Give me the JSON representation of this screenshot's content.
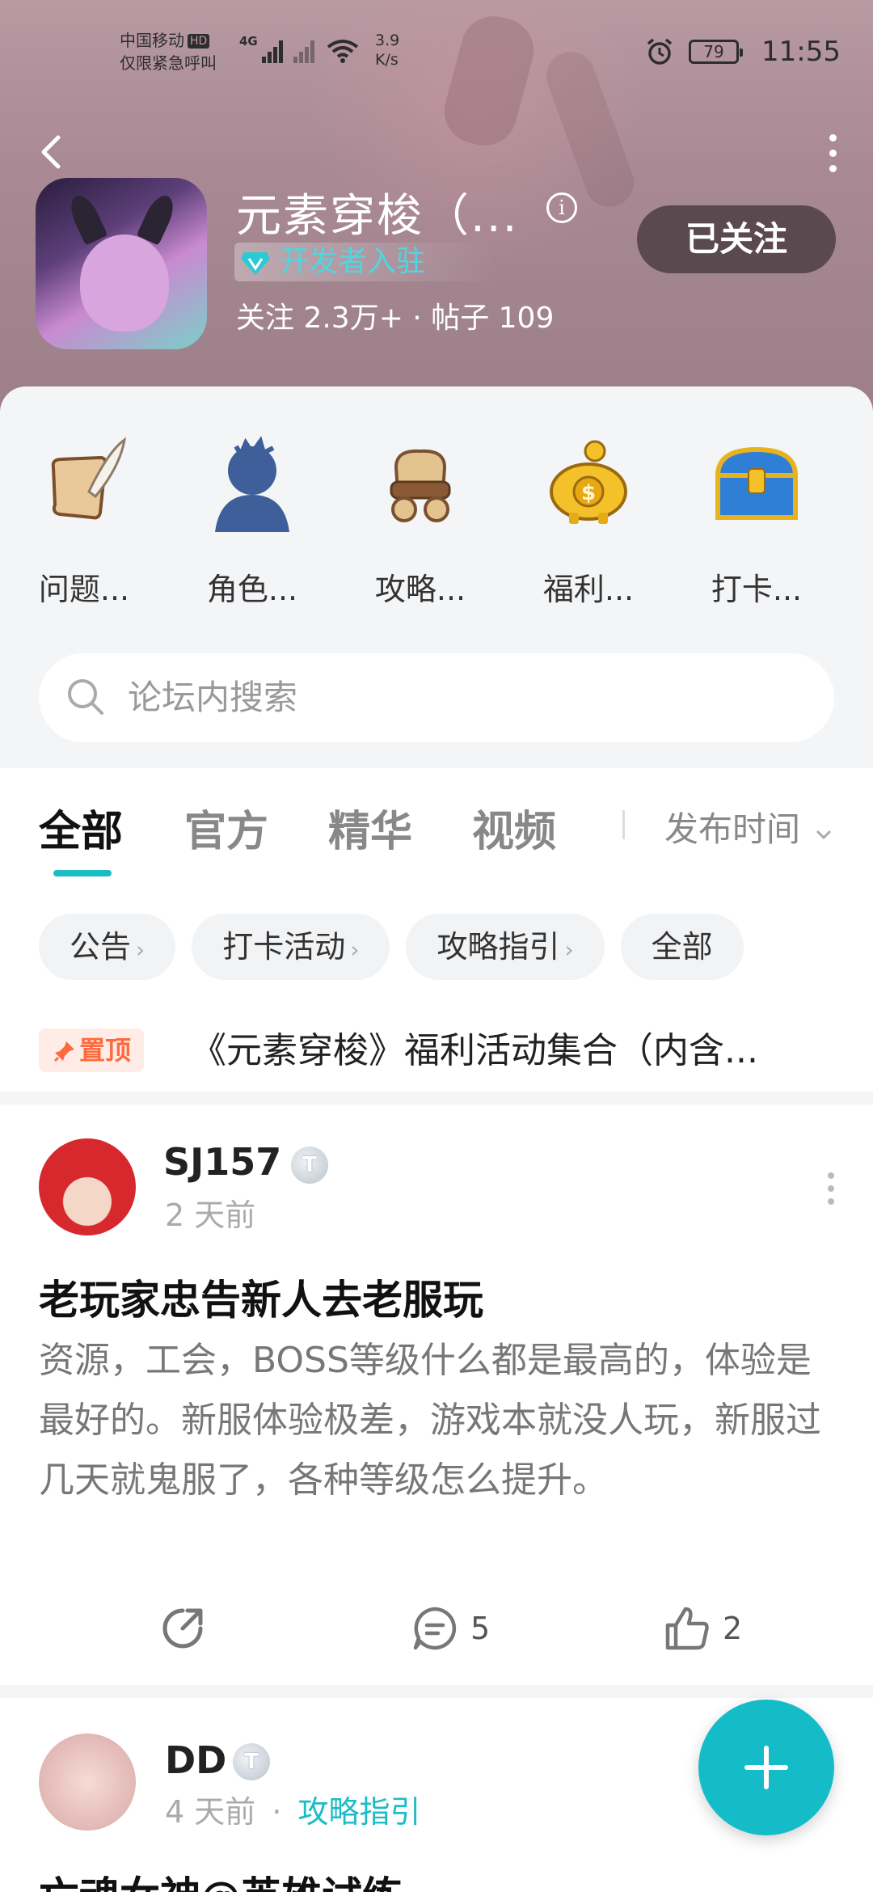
{
  "status_bar": {
    "carrier": "中国移动",
    "hd": "HD",
    "emergency": "仅限紧急呼叫",
    "network": "4G",
    "speed_value": "3.9",
    "speed_unit": "K/s",
    "battery": "79",
    "time": "11:55"
  },
  "header": {
    "title": "元素穿梭（...",
    "info_glyph": "i",
    "dev_badge": "开发者入驻",
    "stats": "关注 2.3万+ · 帖子 109",
    "follow_label": "已关注"
  },
  "shortcuts": [
    {
      "label": "问题...",
      "icon": "scroll-quill-icon"
    },
    {
      "label": "角色...",
      "icon": "character-silhouette-icon"
    },
    {
      "label": "攻略...",
      "icon": "map-scroll-icon"
    },
    {
      "label": "福利...",
      "icon": "piggy-bank-icon"
    },
    {
      "label": "打卡...",
      "icon": "treasure-chest-icon"
    }
  ],
  "search": {
    "placeholder": "论坛内搜索"
  },
  "tabs": [
    {
      "label": "全部",
      "active": true
    },
    {
      "label": "官方"
    },
    {
      "label": "精华"
    },
    {
      "label": "视频"
    }
  ],
  "sort_label": "发布时间",
  "chips": [
    {
      "label": "公告",
      "arrow": "›"
    },
    {
      "label": "打卡活动",
      "arrow": "›"
    },
    {
      "label": "攻略指引",
      "arrow": "›"
    },
    {
      "label": "全部"
    }
  ],
  "pinned": {
    "badge": "置顶",
    "text": "《元素穿梭》福利活动集合（内含..."
  },
  "posts": [
    {
      "user": "SJ157",
      "level": "T",
      "time": "2 天前",
      "title": "老玩家忠告新人去老服玩",
      "body": "资源，工会，BOSS等级什么都是最高的，体验是最好的。新服体验极差，游戏本就没人玩，新服过几天就鬼服了，各种等级怎么提升。",
      "comments": "5",
      "likes": "2"
    },
    {
      "user": "DD",
      "level": "T",
      "time": "4 天前",
      "sep": "·",
      "tag": "攻略指引",
      "title": "亡魂女神@英雄试练"
    }
  ],
  "colors": {
    "accent": "#14bcc7",
    "pin": "#ff6a3d",
    "follow_bg": "#5a4a4f"
  }
}
